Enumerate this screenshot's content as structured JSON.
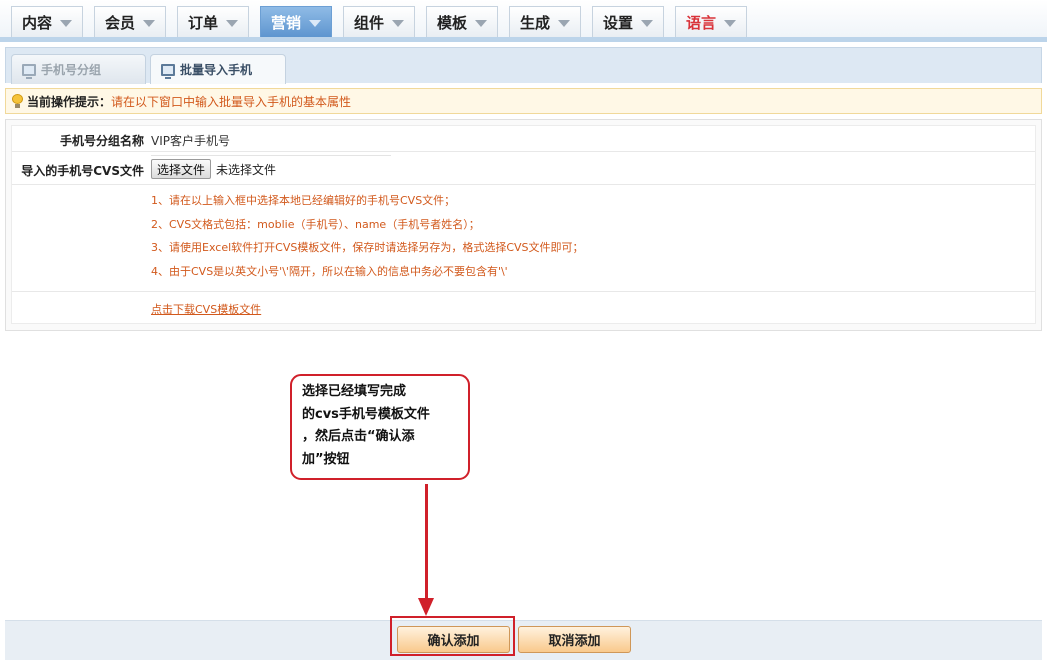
{
  "nav": {
    "tabs": [
      {
        "label": "内容"
      },
      {
        "label": "会员"
      },
      {
        "label": "订单"
      },
      {
        "label": "营销",
        "active": true
      },
      {
        "label": "组件"
      },
      {
        "label": "模板"
      },
      {
        "label": "生成"
      },
      {
        "label": "设置"
      },
      {
        "label": "语言"
      }
    ],
    "colors": {
      "active": "#6a9fd6",
      "language": "#d9333a"
    }
  },
  "subtabs": [
    {
      "label": "手机号分组",
      "active": false
    },
    {
      "label": "批量导入手机",
      "active": true
    }
  ],
  "tip": {
    "label": "当前操作提示：",
    "text": "请在以下窗口中输入批量导入手机的基本属性"
  },
  "form": {
    "group_name_label": "手机号分组名称",
    "group_name_value": "VIP客户手机号",
    "file_label": "导入的手机号CVS文件",
    "file_button": "选择文件",
    "file_status": "未选择文件",
    "notes": [
      "1、请在以上输入框中选择本地已经编辑好的手机号CVS文件；",
      "2、CVS文格式包括：moblie（手机号）、name（手机号者姓名）；",
      "3、请使用Excel软件打开CVS模板文件，保存时请选择另存为，格式选择CVS文件即可；",
      "4、由于CVS是以英文小号'\\'隔开，所以在输入的信息中务必不要包含有'\\'"
    ],
    "download_link": "点击下载CVS模板文件"
  },
  "callout": {
    "lines": [
      "选择已经填写完成",
      "的cvs手机号模板文件",
      "，然后点击“确认添",
      "加”按钮"
    ],
    "color": "#d0202a"
  },
  "buttons": {
    "confirm": "确认添加",
    "cancel": "取消添加"
  }
}
